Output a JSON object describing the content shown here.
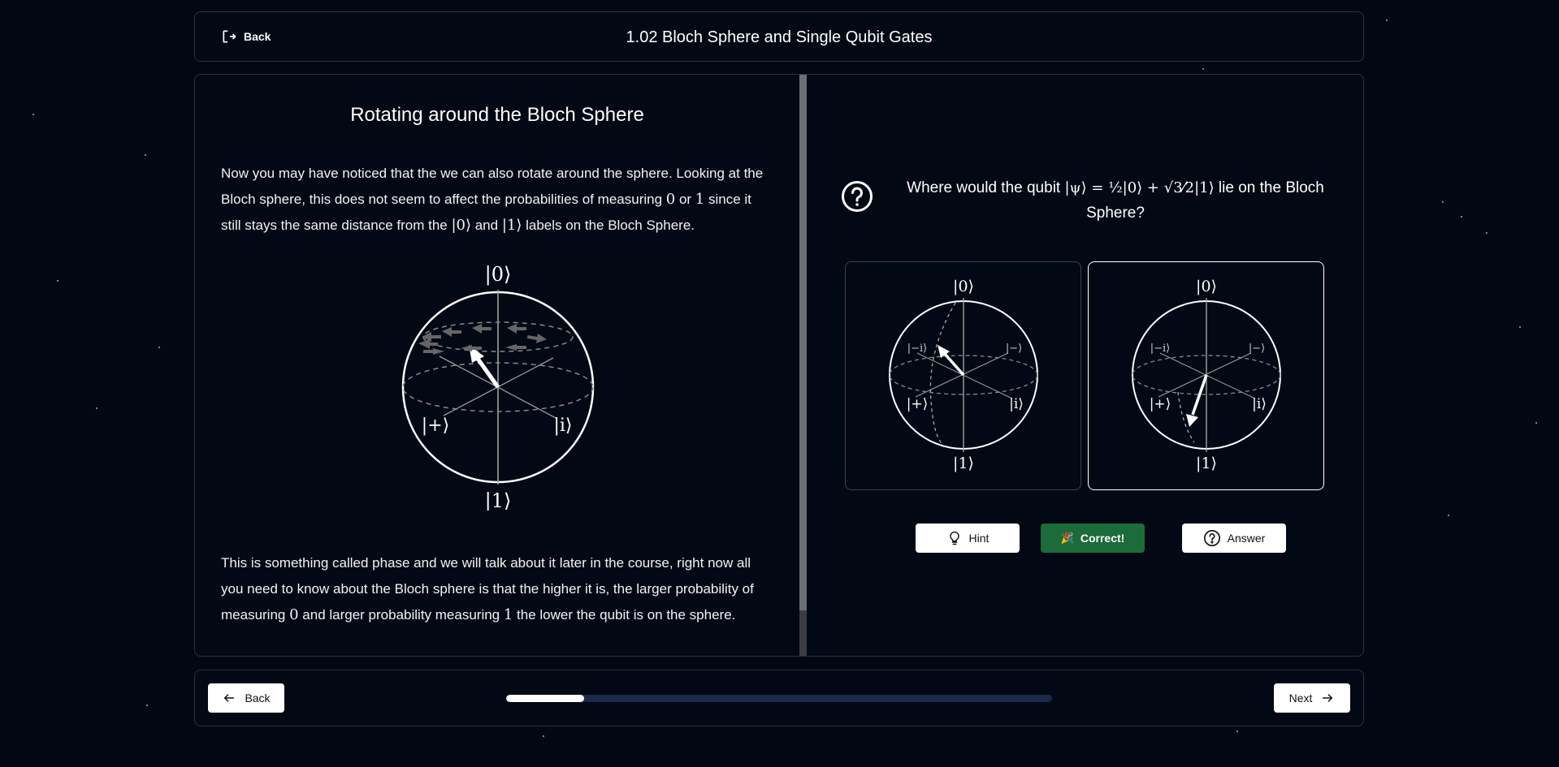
{
  "header": {
    "back_label": "Back",
    "title": "1.02 Bloch Sphere and Single Qubit Gates"
  },
  "lesson": {
    "title": "Rotating around the Bloch Sphere",
    "p1_a": "Now you may have noticed that the we can also rotate around the sphere. Looking at the Bloch sphere, this does not seem to affect the probabilities of measuring ",
    "p1_zero": "0",
    "p1_or": " or ",
    "p1_one": "1",
    "p1_b": " since it still stays the same distance from the ",
    "p1_ket0": "|0⟩",
    "p1_and": " and ",
    "p1_ket1": "|1⟩",
    "p1_c": " labels on the Bloch Sphere.",
    "p2_a": "This is something called phase and we will talk about it later in the course, right now all you need to know about the Bloch sphere is that the higher it is, the larger probability of measuring ",
    "p2_zero": "0",
    "p2_b": " and larger probability measuring ",
    "p2_one": "1",
    "p2_c": " the lower the qubit is on the sphere."
  },
  "bloch_labels": {
    "zero": "|0⟩",
    "one": "|1⟩",
    "plus": "|+⟩",
    "minus": "|−⟩",
    "i": "|i⟩",
    "minus_i": "|−i⟩"
  },
  "question": {
    "prefix": "Where would the qubit ",
    "formula": "|ψ⟩ = ½|0⟩ + √3⁄2|1⟩",
    "suffix": " lie on the Bloch Sphere?"
  },
  "options": [
    {
      "label": "upper-hemisphere",
      "selected": false
    },
    {
      "label": "lower-hemisphere",
      "selected": true
    }
  ],
  "buttons": {
    "hint": "Hint",
    "correct": "Correct!",
    "correct_emoji": "🎉",
    "answer": "Answer"
  },
  "footer": {
    "back_label": "Back",
    "next_label": "Next",
    "progress": 0.143
  },
  "colors": {
    "background": "#020711",
    "panel_border": "#2a3140",
    "correct_green": "#1c6b3a",
    "progress_track": "#1b2a4a"
  }
}
